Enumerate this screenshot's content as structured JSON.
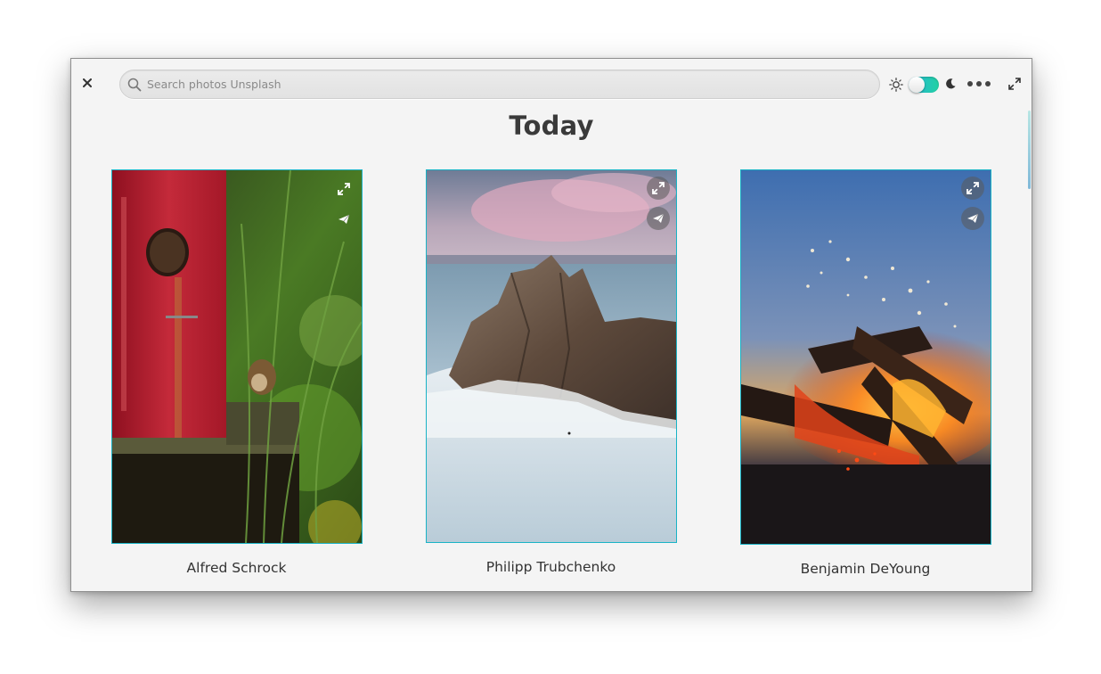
{
  "window": {
    "search": {
      "placeholder": "Search photos Unsplash",
      "value": ""
    },
    "theme_toggle": {
      "state": "light"
    },
    "icons": {
      "close": "close-icon",
      "search": "search-icon",
      "sun": "sun-icon",
      "moon": "moon-icon",
      "more": "more-icon",
      "maximize": "maximize-icon"
    }
  },
  "main": {
    "title": "Today",
    "photos": [
      {
        "author": "Alfred Schrock",
        "subject": "red birdhouse with small bird and grass"
      },
      {
        "author": "Philipp Trubchenko",
        "subject": "rocky cliff on frozen lake at dusk"
      },
      {
        "author": "Benjamin DeYoung",
        "subject": "campfire with burning logs and sparks"
      }
    ],
    "card_actions": [
      "expand-icon",
      "send-icon"
    ]
  },
  "colors": {
    "accent": "#19b3c6",
    "toggle_start": "#27b6d8",
    "toggle_end": "#22d1a4",
    "window_bg": "#f4f4f4"
  }
}
